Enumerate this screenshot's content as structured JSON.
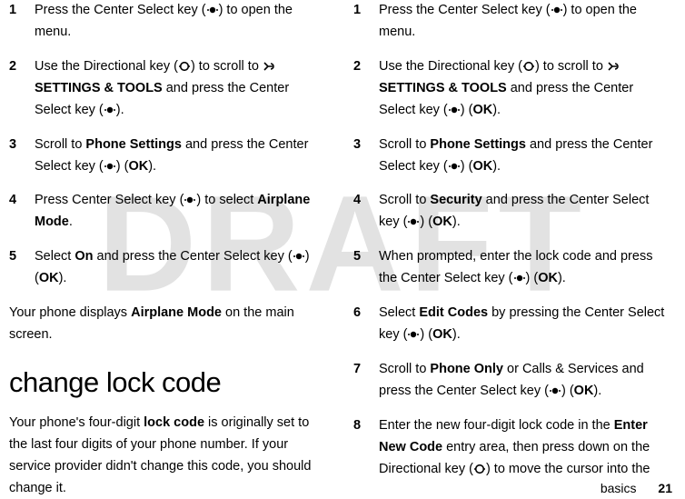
{
  "watermark": "DRAFT",
  "left": {
    "steps": [
      {
        "num": "1",
        "pre": "Press the Center Select key (",
        "post": ") to open the menu."
      },
      {
        "num": "2",
        "pre": "Use the Directional key (",
        "mid": ") to scroll to ",
        "tools_icon_after": true,
        "tools": "SETTINGS & TOOLS",
        "post2": " and press the Center Select key (",
        "post3": ")."
      },
      {
        "num": "3",
        "pre": "Scroll to ",
        "target": "Phone Settings",
        "mid": " and press the Center Select key (",
        "ok": "OK",
        "post": ")."
      },
      {
        "num": "4",
        "pre": "Press Center Select key (",
        "mid": ") to select ",
        "target": "Airplane Mode",
        "post": "."
      },
      {
        "num": "5",
        "pre": "Select ",
        "target": "On",
        "mid": " and press the Center Select key (",
        "ok": "OK",
        "post": ")."
      }
    ],
    "after": {
      "pre": "Your phone displays ",
      "target": "Airplane Mode",
      "post": " on the main screen."
    },
    "heading": "change lock code",
    "intro": {
      "pre": "Your phone's four-digit ",
      "bold": "lock code",
      "post": " is originally set to the last four digits of your phone number. If your service provider didn't change this code, you should change it."
    }
  },
  "right": {
    "steps": [
      {
        "num": "1",
        "pre": "Press the Center Select key (",
        "post": ") to open the menu."
      },
      {
        "num": "2",
        "pre": "Use the Directional key (",
        "mid": ") to scroll to ",
        "tools": "SETTINGS & TOOLS",
        "post2": " and press the Center Select key (",
        "ok": "OK",
        "post3": ")."
      },
      {
        "num": "3",
        "pre": "Scroll to ",
        "target": "Phone Settings",
        "mid": " and press the Center Select key (",
        "ok": "OK",
        "post": ")."
      },
      {
        "num": "4",
        "pre": "Scroll to ",
        "target": "Security",
        "mid": " and press the Center Select key (",
        "ok": "OK",
        "post": ")."
      },
      {
        "num": "5",
        "pre": "When prompted, enter the lock code and press the Center Select key (",
        "ok": "OK",
        "post": ")."
      },
      {
        "num": "6",
        "pre": "Select ",
        "target": "Edit Codes",
        "mid": " by pressing the Center Select key (",
        "ok": "OK",
        "post": ")."
      },
      {
        "num": "7",
        "pre": "Scroll to ",
        "target": "Phone Only",
        "mid": " or Calls & Services and press the Center Select key (",
        "ok": "OK",
        "post": ")."
      },
      {
        "num": "8",
        "pre": "Enter the new four-digit lock code in the ",
        "target": "Enter New Code",
        "mid": " entry area, then press down on the Directional key (",
        "post": ") to move the cursor into the"
      }
    ]
  },
  "footer": {
    "label": "basics",
    "page": "21"
  }
}
